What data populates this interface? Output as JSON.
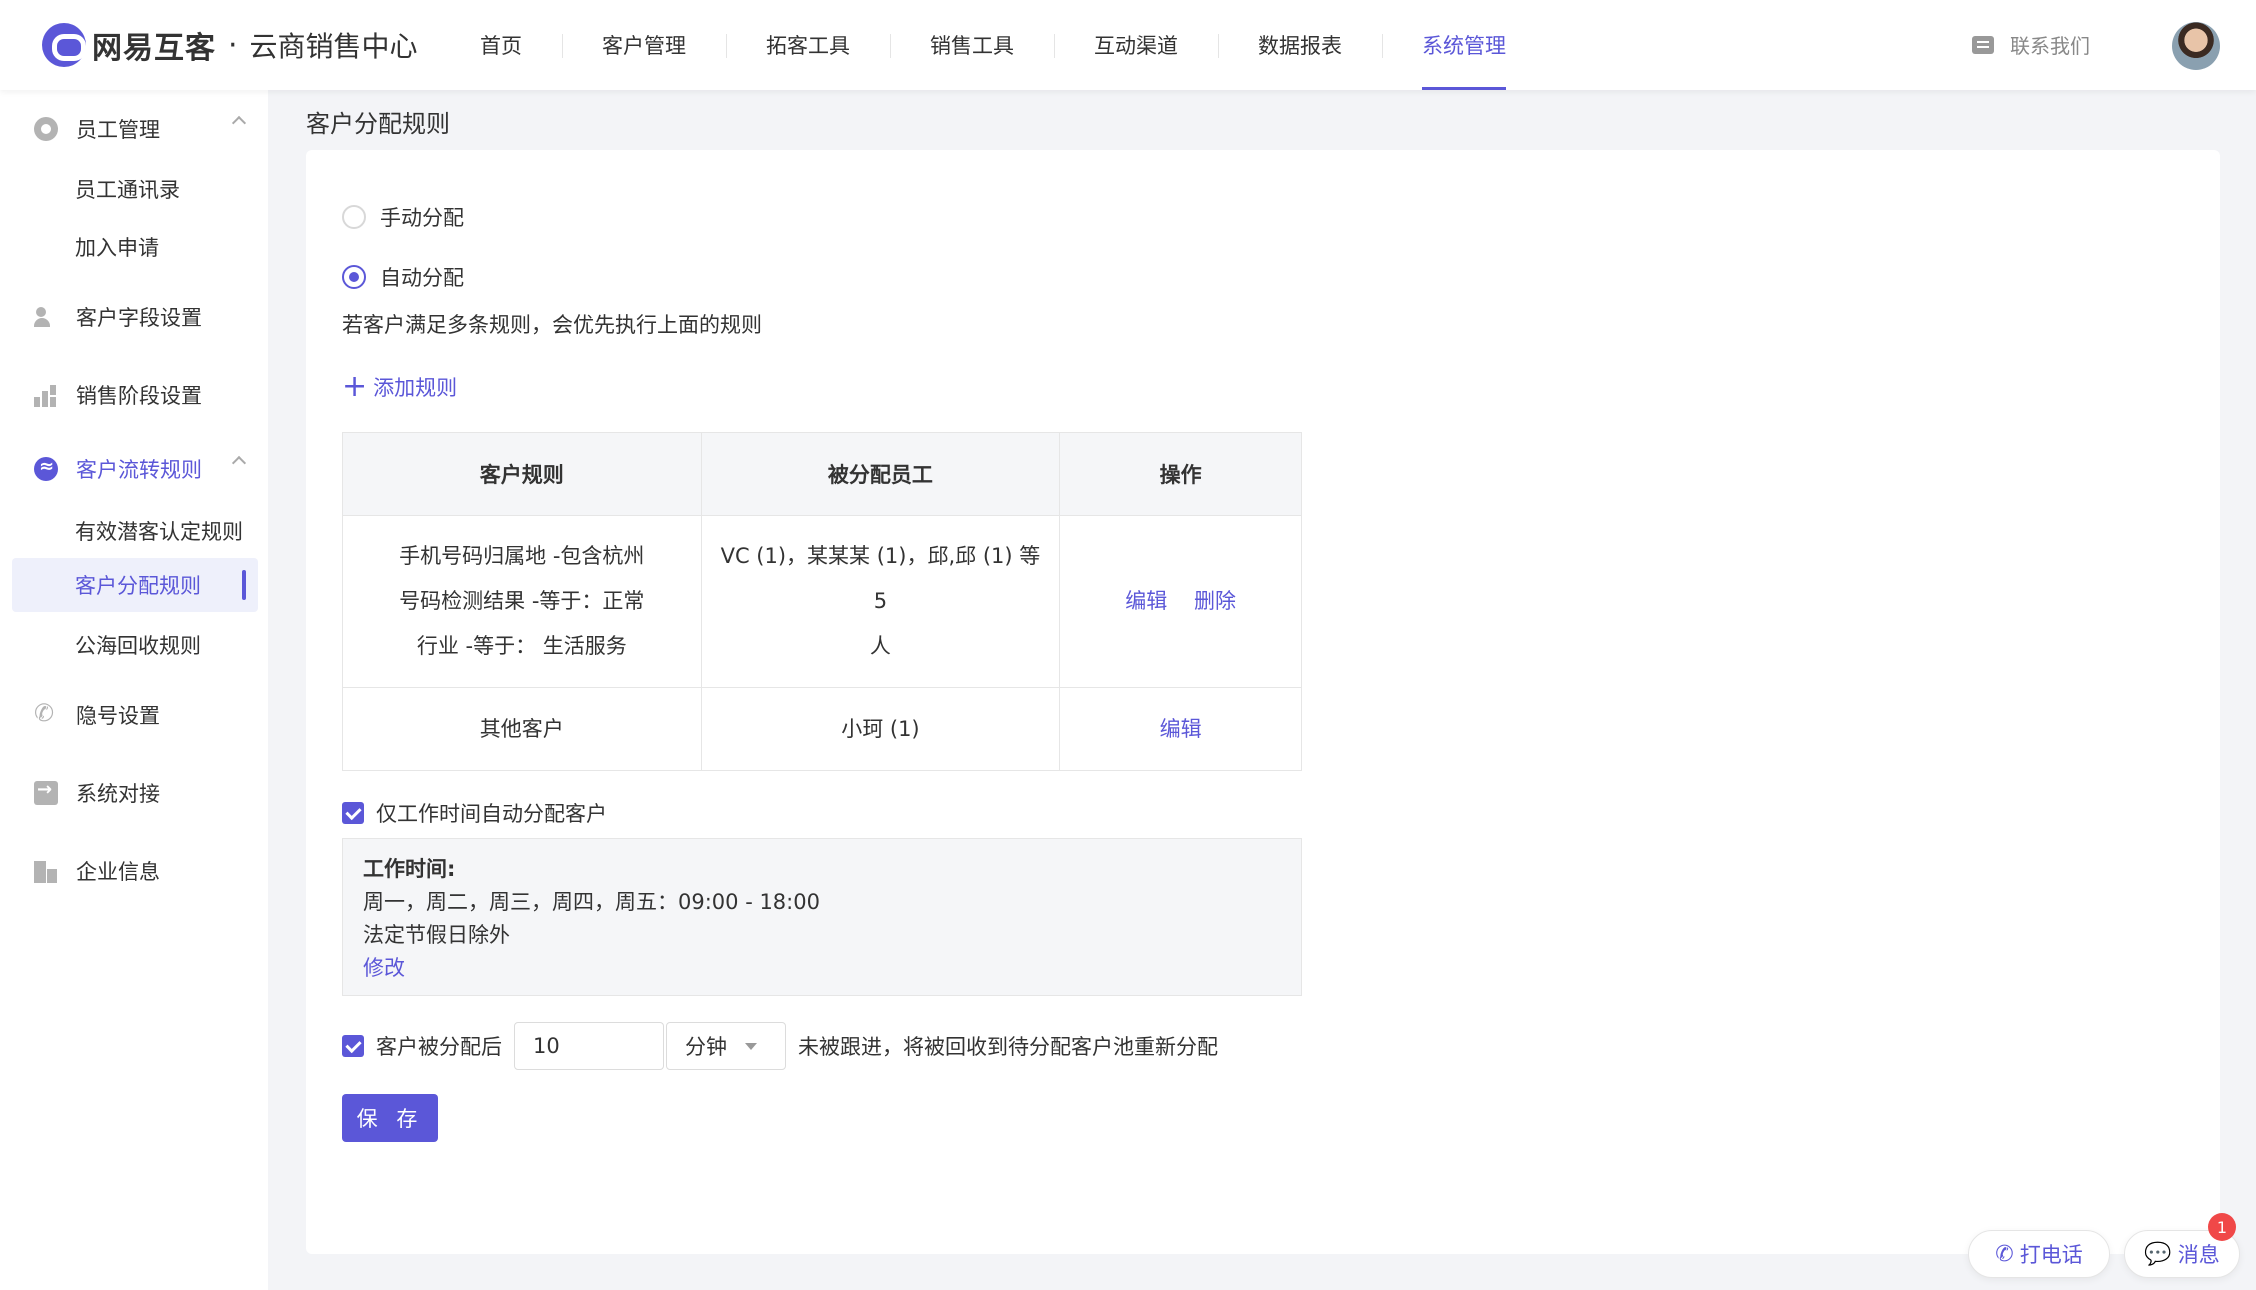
{
  "brand": {
    "name": "网易互客",
    "dot": "·",
    "sub": "云商销售中心"
  },
  "nav": [
    {
      "label": "首页"
    },
    {
      "label": "客户管理"
    },
    {
      "label": "拓客工具"
    },
    {
      "label": "销售工具"
    },
    {
      "label": "互动渠道"
    },
    {
      "label": "数据报表"
    },
    {
      "label": "系统管理",
      "active": true
    }
  ],
  "header": {
    "contact_label": "联系我们"
  },
  "sidebar": {
    "groups": [
      {
        "label": "员工管理",
        "icon": "gear-icon",
        "expanded": true
      },
      {
        "label": "客户字段设置",
        "icon": "person-icon"
      },
      {
        "label": "销售阶段设置",
        "icon": "stairs-icon"
      },
      {
        "label": "客户流转规则",
        "icon": "flow-icon",
        "expanded": true,
        "active": true
      },
      {
        "label": "隐号设置",
        "icon": "phone-icon"
      },
      {
        "label": "系统对接",
        "icon": "system-link-icon"
      },
      {
        "label": "企业信息",
        "icon": "building-icon"
      }
    ],
    "staff_subs": [
      "员工通讯录",
      "加入申请"
    ],
    "flow_subs": [
      "有效潜客认定规则",
      "客户分配规则",
      "公海回收规则"
    ]
  },
  "page": {
    "title": "客户分配规则",
    "manual_label": "手动分配",
    "auto_label": "自动分配",
    "selected_mode": "自动分配",
    "hint": "若客户满足多条规则，会优先执行上面的规则",
    "add_rule": "添加规则",
    "table": {
      "headers": [
        "客户规则",
        "被分配员工",
        "操作"
      ],
      "rows": [
        {
          "conditions": [
            "手机号码归属地 -包含杭州",
            "号码检测结果 -等于：正常",
            "行业 -等于：  生活服务"
          ],
          "staff_line1": "VC (1)，某某某 (1)，邱,邱 (1) 等5",
          "staff_line2": "人",
          "edit": "编辑",
          "delete": "删除"
        },
        {
          "conditions": [
            "其他客户"
          ],
          "staff_line1": "小珂 (1)",
          "edit": "编辑"
        }
      ]
    },
    "worktime_check_label": "仅工作时间自动分配客户",
    "worktime": {
      "title": "工作时间:",
      "days": "周一，周二，周三，周四，周五：09:00 - 18:00",
      "holiday": "法定节假日除外",
      "edit": "修改"
    },
    "recycle": {
      "prefix": "客户被分配后",
      "value": "10",
      "unit": "分钟",
      "suffix": "未被跟进，将被回收到待分配客户池重新分配"
    },
    "save": "保 存"
  },
  "floating": {
    "call": "打电话",
    "message": "消息",
    "badge": "1"
  },
  "colors": {
    "accent": "#5b57d8",
    "badge": "#f04848"
  }
}
